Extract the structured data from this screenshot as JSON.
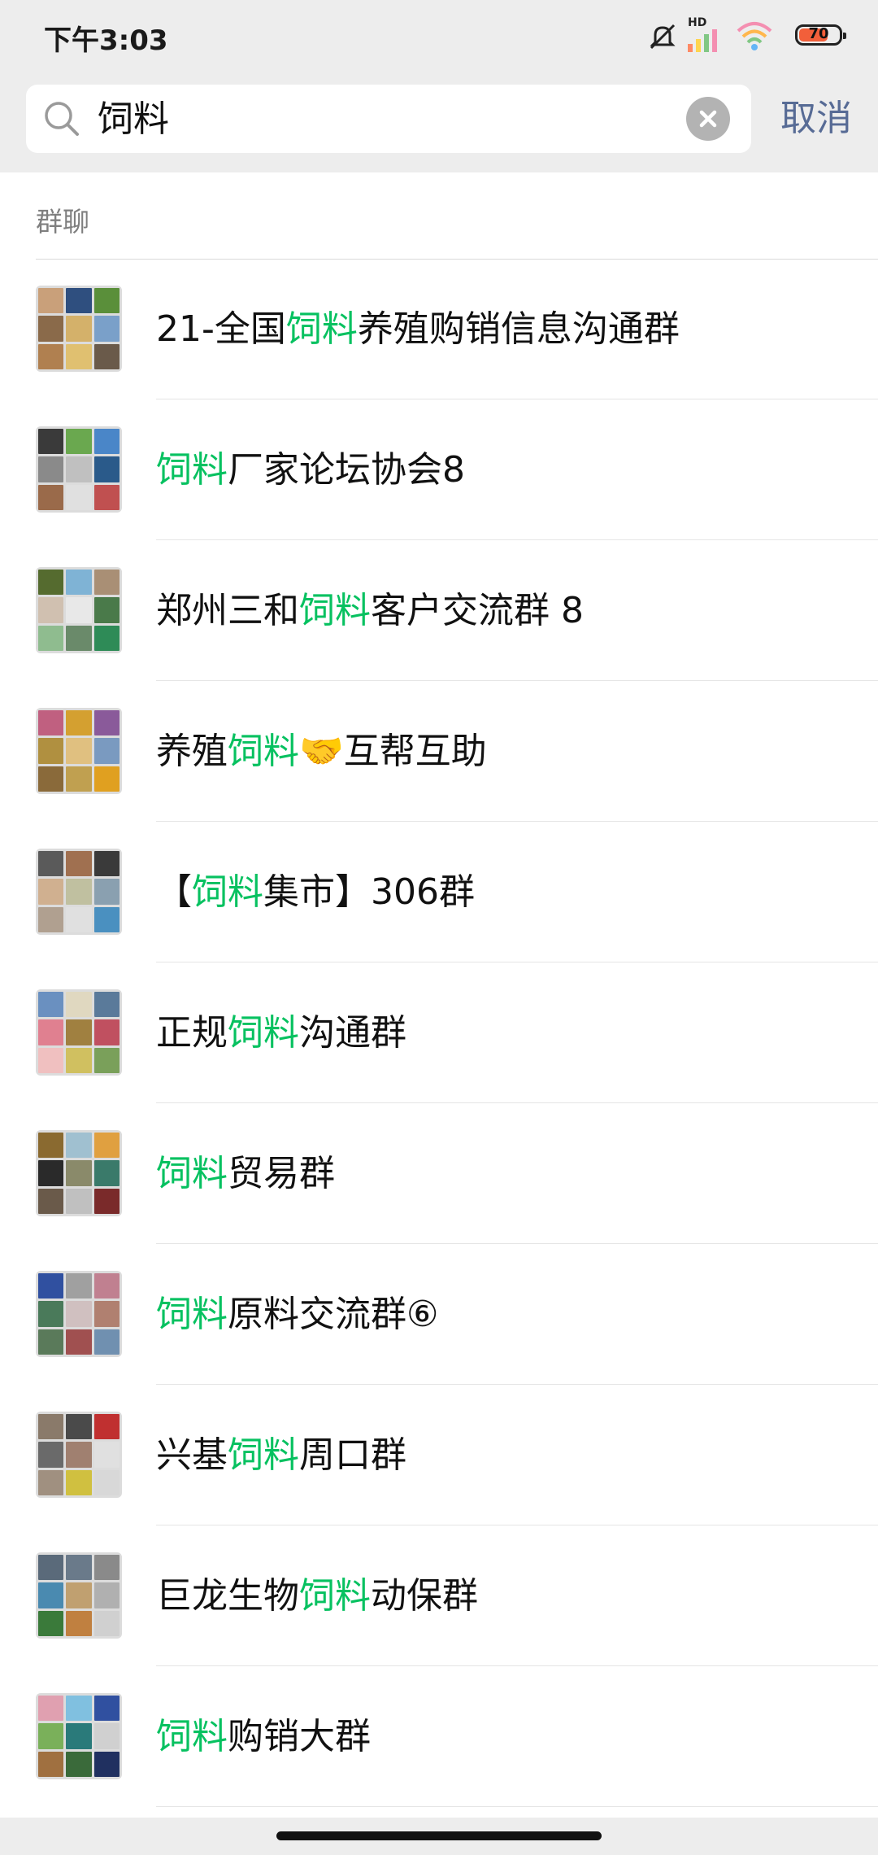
{
  "status_bar": {
    "time": "下午3:03",
    "hd_label": "HD",
    "battery": "70",
    "icons": [
      "mute-icon",
      "signal-icon",
      "wifi-icon",
      "battery-icon"
    ]
  },
  "search": {
    "query": "饲料",
    "cancel_label": "取消"
  },
  "section": {
    "title": "群聊"
  },
  "colors": {
    "highlight": "#07c160",
    "link": "#576b95",
    "background_bar": "#ededed"
  },
  "groups": [
    {
      "before": "21-全国",
      "match": "饲料",
      "after": "养殖购销信息沟通群"
    },
    {
      "before": "",
      "match": "饲料",
      "after": "厂家论坛协会8"
    },
    {
      "before": "郑州三和",
      "match": "饲料",
      "after": "客户交流群 8"
    },
    {
      "before": "养殖",
      "match": "饲料",
      "after": "🤝互帮互助"
    },
    {
      "before": "【",
      "match": "饲料",
      "after": "集市】306群"
    },
    {
      "before": "正规",
      "match": "饲料",
      "after": "沟通群"
    },
    {
      "before": "",
      "match": "饲料",
      "after": "贸易群"
    },
    {
      "before": "",
      "match": "饲料",
      "after": "原料交流群⑥"
    },
    {
      "before": "兴基",
      "match": "饲料",
      "after": "周口群"
    },
    {
      "before": "巨龙生物",
      "match": "饲料",
      "after": "动保群"
    },
    {
      "before": "",
      "match": "饲料",
      "after": "购销大群"
    }
  ]
}
